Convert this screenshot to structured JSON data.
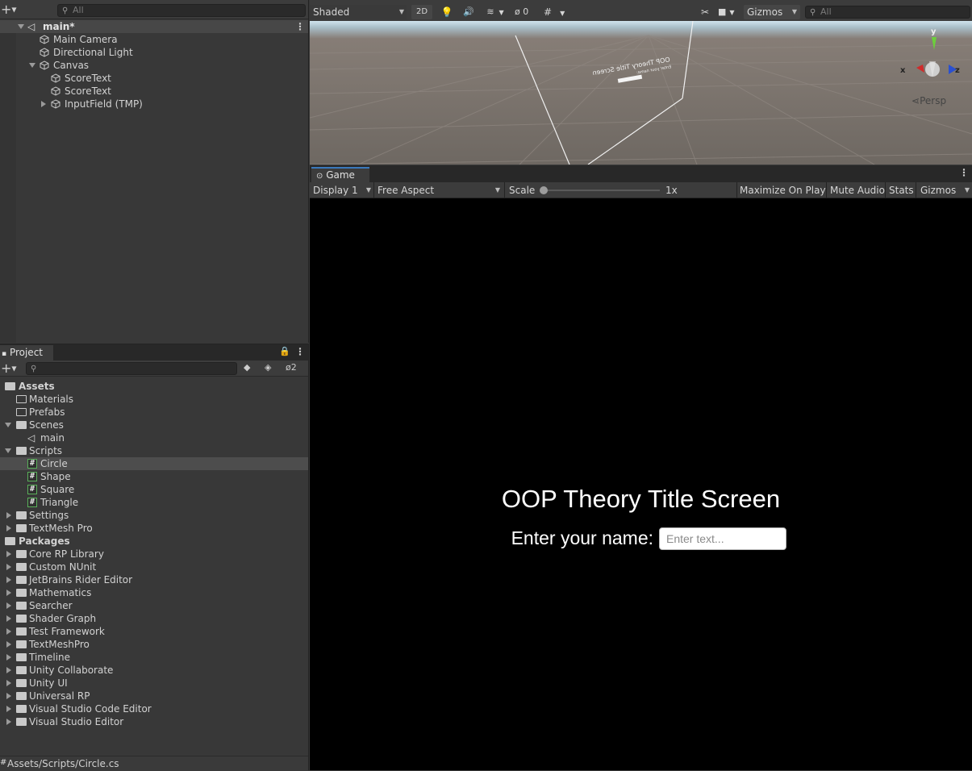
{
  "hierarchy": {
    "search_placeholder": "All",
    "scene_name": "main*",
    "items": [
      "Main Camera",
      "Directional Light",
      "Canvas",
      "ScoreText",
      "ScoreText",
      "InputField (TMP)"
    ]
  },
  "scene_toolbar": {
    "shading": "Shaded",
    "mode_2d": "2D",
    "hidden_count": "0",
    "gizmos": "Gizmos",
    "search_placeholder": "All",
    "persp": "Persp",
    "axis_x": "x",
    "axis_y": "y",
    "axis_z": "z"
  },
  "scene_text": {
    "line1": "OOP Theory Title Screen",
    "line2": "Enter your name:"
  },
  "game": {
    "tab": "Game",
    "display": "Display 1",
    "aspect": "Free Aspect",
    "scale_label": "Scale",
    "scale_value": "1x",
    "scale_fraction": 0,
    "maximize": "Maximize On Play",
    "mute": "Mute Audio",
    "stats": "Stats",
    "gizmos": "Gizmos",
    "title": "OOP Theory Title Screen",
    "name_label": "Enter your name:",
    "input_placeholder": "Enter text..."
  },
  "project": {
    "tab": "Project",
    "hidden_count": "2",
    "assets_label": "Assets",
    "assets": [
      "Materials",
      "Prefabs",
      "Scenes",
      "main",
      "Scripts",
      "Circle",
      "Shape",
      "Square",
      "Triangle",
      "Settings",
      "TextMesh Pro"
    ],
    "packages_label": "Packages",
    "packages": [
      "Core RP Library",
      "Custom NUnit",
      "JetBrains Rider Editor",
      "Mathematics",
      "Searcher",
      "Shader Graph",
      "Test Framework",
      "TextMeshPro",
      "Timeline",
      "Unity Collaborate",
      "Unity UI",
      "Universal RP",
      "Visual Studio Code Editor",
      "Visual Studio Editor"
    ],
    "status_path": "Assets/Scripts/Circle.cs"
  },
  "colors": {
    "panel_bg": "#383838",
    "toolbar_bg": "#3c3c3c",
    "selected_row": "#4d4d4d",
    "game_bg": "#000000"
  }
}
